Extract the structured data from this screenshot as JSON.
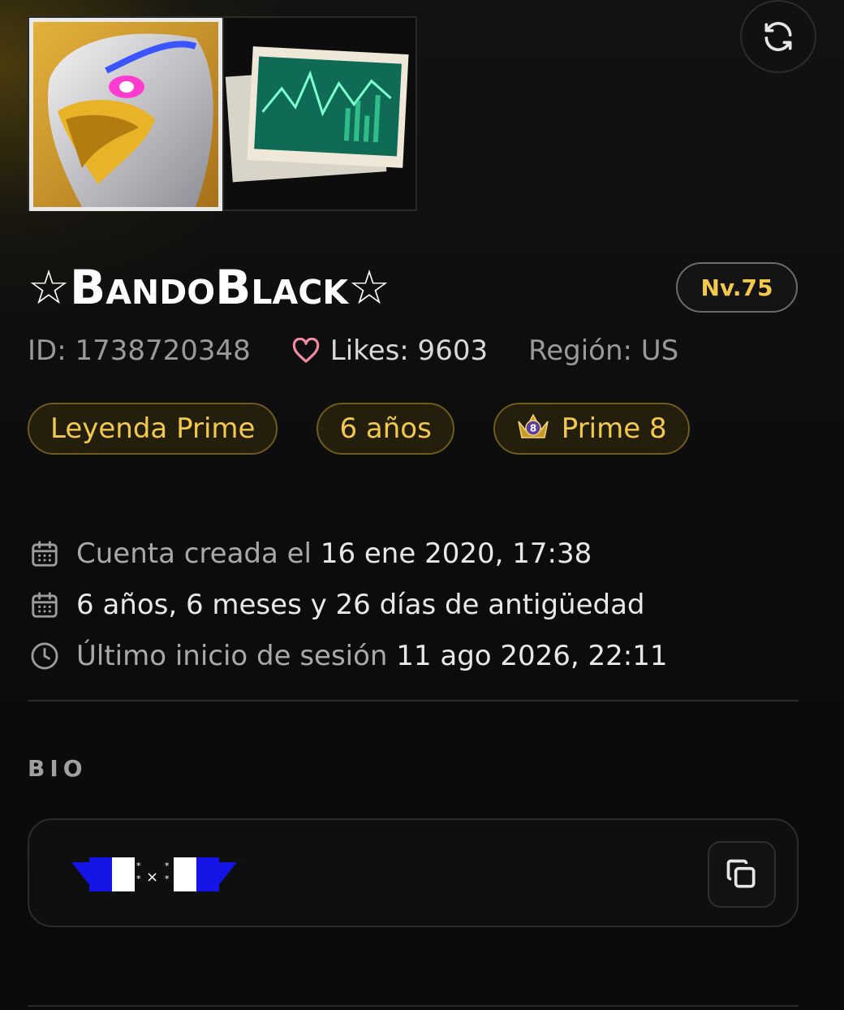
{
  "profile": {
    "name": "☆BandoBlack☆",
    "level": "Nv.75",
    "id": "ID: 1738720348",
    "likes": "Likes: 9603",
    "region": "Región: US"
  },
  "badges": {
    "rank": "Leyenda Prime",
    "years": "6 años",
    "prime": "Prime 8",
    "prime_crown_number": "8"
  },
  "info": {
    "created_label": "Cuenta creada el",
    "created_value": "16 ene 2020, 17:38",
    "age": "6 años, 6 meses y 26 días de antigüedad",
    "last_login_label": "Último inicio de sesión",
    "last_login_value": "11 ago 2026, 22:11"
  },
  "bio": {
    "heading": "BIO"
  },
  "colors": {
    "accent_gold": "#f2c94c",
    "flag_blue": "#1414e6"
  },
  "icons": {
    "refresh": "refresh-icon",
    "heart": "heart-icon",
    "calendar": "calendar-icon",
    "clock": "clock-icon",
    "copy": "copy-icon",
    "crown": "crown-icon"
  }
}
